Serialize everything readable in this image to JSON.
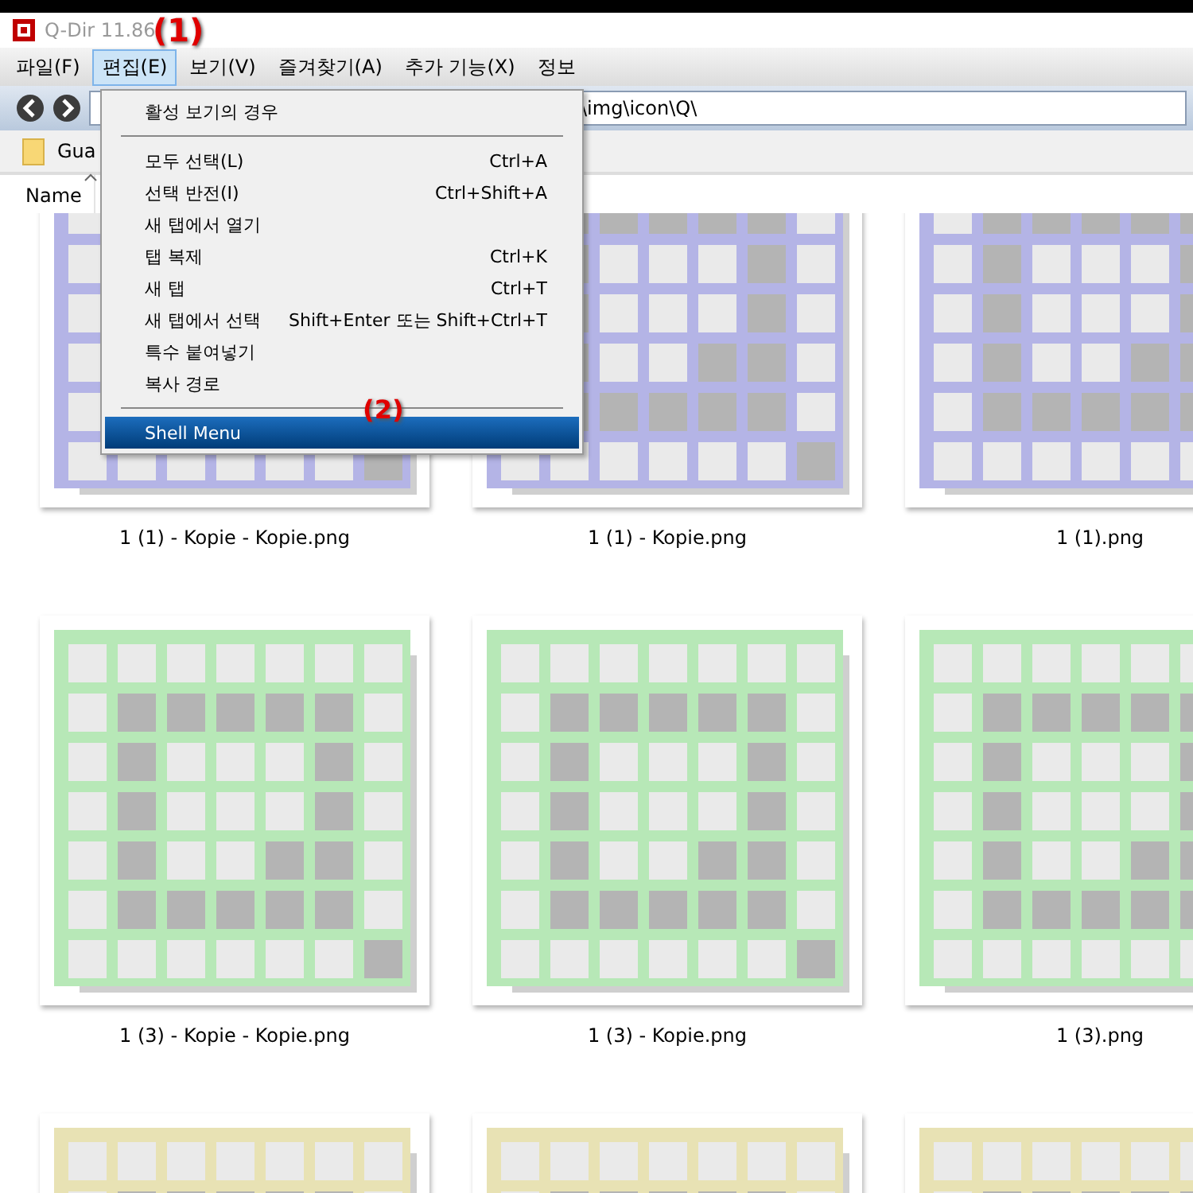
{
  "window": {
    "title": "Q-Dir 11.86"
  },
  "menu_bar": [
    {
      "label": "파일(F)",
      "selected": false
    },
    {
      "label": "편집(E)",
      "selected": true
    },
    {
      "label": "보기(V)",
      "selected": false
    },
    {
      "label": "즐겨찾기(A)",
      "selected": false
    },
    {
      "label": "추가 기능(X)",
      "selected": false
    },
    {
      "label": "정보",
      "selected": false
    }
  ],
  "address_bar": {
    "value": "\\img\\icon\\Q\\"
  },
  "tab": {
    "label": "Gua"
  },
  "column_header": {
    "label": "Name"
  },
  "files": [
    {
      "name": "1 (1) - Kopie - Kopie.png",
      "color": "#b4b4e6"
    },
    {
      "name": "1 (1) - Kopie.png",
      "color": "#b4b4e6"
    },
    {
      "name": "1 (1).png",
      "color": "#b4b4e6"
    },
    {
      "name": "1 (3) - Kopie - Kopie.png",
      "color": "#b7e8b7"
    },
    {
      "name": "1 (3) - Kopie.png",
      "color": "#b7e8b7"
    },
    {
      "name": "1 (3).png",
      "color": "#b7e8b7"
    },
    {
      "color": "#e8e2b4"
    },
    {
      "color": "#e8e2b4"
    },
    {
      "color": "#e8e2b4"
    }
  ],
  "dropdown_menu": [
    {
      "kind": "header",
      "label": "활성 보기의 경우",
      "selected": false
    },
    {
      "kind": "separator"
    },
    {
      "kind": "item",
      "label": "모두 선택(L)",
      "shortcut": "Ctrl+A",
      "selected": false
    },
    {
      "kind": "item",
      "label": "선택 반전(I)",
      "shortcut": "Ctrl+Shift+A",
      "selected": false
    },
    {
      "kind": "item",
      "label": "새 탭에서 열기",
      "selected": false
    },
    {
      "kind": "item",
      "label": "탭 복제",
      "shortcut": "Ctrl+K",
      "selected": false
    },
    {
      "kind": "item",
      "label": "새 탭",
      "shortcut": "Ctrl+T",
      "selected": false
    },
    {
      "kind": "item",
      "label": "새 탭에서 선택",
      "shortcut": "Shift+Enter 또는 Shift+Ctrl+T",
      "selected": false
    },
    {
      "kind": "item",
      "label": "특수 붙여넣기",
      "selected": false
    },
    {
      "kind": "item",
      "label": "복사 경로",
      "selected": false
    },
    {
      "kind": "separator"
    },
    {
      "kind": "item",
      "label": "Shell Menu",
      "selected": true
    }
  ],
  "annotations": [
    "(1)",
    "(2)"
  ]
}
